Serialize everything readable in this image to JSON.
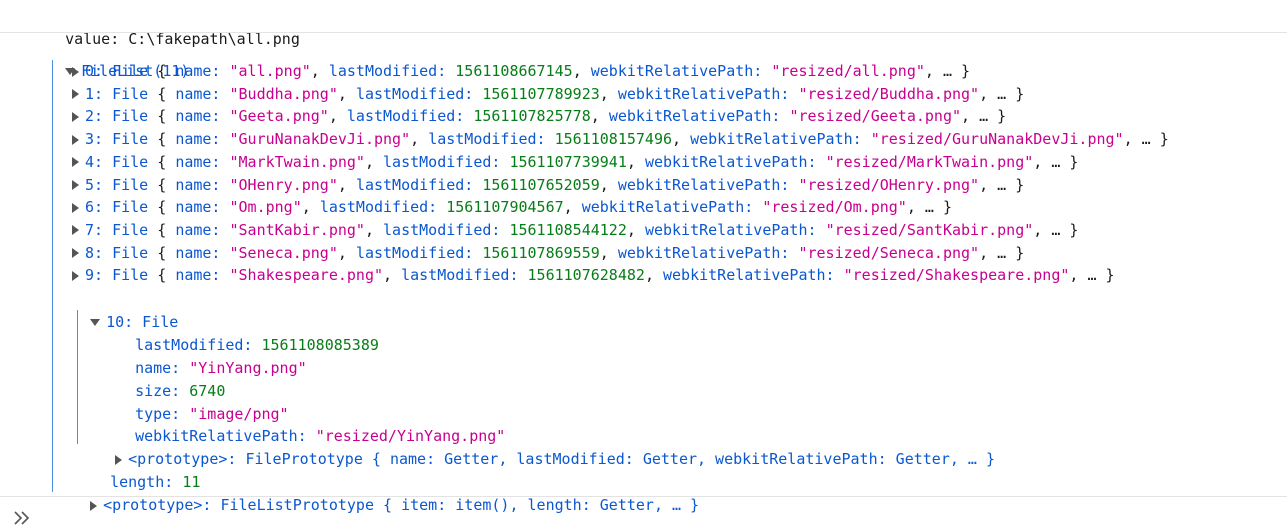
{
  "value_line": {
    "label": "value:",
    "text": "C:\\fakepath\\all.png"
  },
  "filelist": {
    "title": "FileList(11)"
  },
  "entries": [
    {
      "idx": "0",
      "name": "\"all.png\"",
      "lastModified": "1561108667145",
      "path": "\"resized/all.png\""
    },
    {
      "idx": "1",
      "name": "\"Buddha.png\"",
      "lastModified": "1561107789923",
      "path": "\"resized/Buddha.png\""
    },
    {
      "idx": "2",
      "name": "\"Geeta.png\"",
      "lastModified": "1561107825778",
      "path": "\"resized/Geeta.png\""
    },
    {
      "idx": "3",
      "name": "\"GuruNanakDevJi.png\"",
      "lastModified": "1561108157496",
      "path": "\"resized/GuruNanakDevJi.png\""
    },
    {
      "idx": "4",
      "name": "\"MarkTwain.png\"",
      "lastModified": "1561107739941",
      "path": "\"resized/MarkTwain.png\""
    },
    {
      "idx": "5",
      "name": "\"OHenry.png\"",
      "lastModified": "1561107652059",
      "path": "\"resized/OHenry.png\""
    },
    {
      "idx": "6",
      "name": "\"Om.png\"",
      "lastModified": "1561107904567",
      "path": "\"resized/Om.png\""
    },
    {
      "idx": "7",
      "name": "\"SantKabir.png\"",
      "lastModified": "1561108544122",
      "path": "\"resized/SantKabir.png\""
    },
    {
      "idx": "8",
      "name": "\"Seneca.png\"",
      "lastModified": "1561107869559",
      "path": "\"resized/Seneca.png\""
    },
    {
      "idx": "9",
      "name": "\"Shakespeare.png\"",
      "lastModified": "1561107628482",
      "path": "\"resized/Shakespeare.png\""
    }
  ],
  "labels": {
    "file": "File",
    "open_brace": "{",
    "name_key": "name:",
    "lastModified_key": "lastModified:",
    "path_key": "webkitRelativePath:",
    "ellipsis_close": ", … }",
    "comma": ","
  },
  "expanded": {
    "header": "10: File",
    "lastModified_key": "lastModified:",
    "lastModified": "1561108085389",
    "name_key": "name:",
    "name": "\"YinYang.png\"",
    "size_key": "size:",
    "size": "6740",
    "type_key": "type:",
    "type": "\"image/png\"",
    "path_key": "webkitRelativePath:",
    "path": "\"resized/YinYang.png\"",
    "prototype": "<prototype>: FilePrototype { name: Getter, lastModified: Getter, webkitRelativePath: Getter, … }"
  },
  "length": {
    "key": "length:",
    "value": "11"
  },
  "list_prototype": "<prototype>: FileListPrototype { item: item(), length: Getter, … }",
  "colors": {
    "key": "#0b57d0",
    "string": "#c8008f",
    "number": "#067d17"
  },
  "icons": {
    "expand": "triangle-right-icon",
    "collapse": "triangle-down-icon",
    "prompt": "double-chevron-right-icon"
  }
}
